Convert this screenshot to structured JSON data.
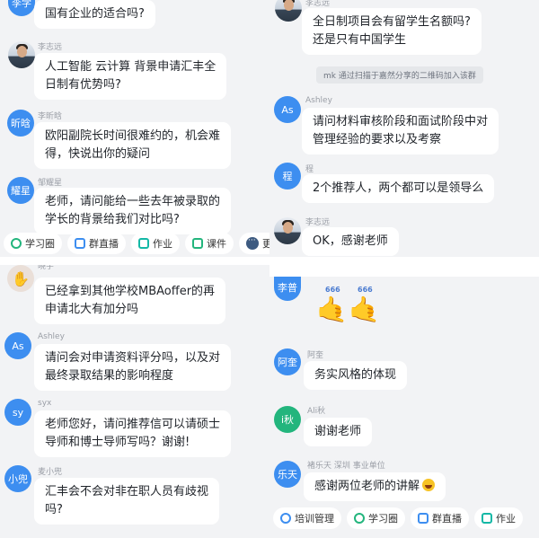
{
  "top_left": {
    "messages": [
      {
        "avatar": "李学",
        "sender": "",
        "text": "国有企业的适合吗?"
      },
      {
        "avatar": "",
        "sender": "李志远",
        "text": "人工智能 云计算 背景申请汇丰全\n日制有优势吗?"
      },
      {
        "avatar": "昕晗",
        "sender": "李昕晗",
        "text": "欧阳副院长时间很难约的，机会难\n得，快说出你的疑问"
      },
      {
        "avatar": "耀星",
        "sender": "邹耀星",
        "text": "老师，请问能给一些去年被录取的\n学长的背景给我们对比吗?"
      }
    ],
    "toolbar": [
      "学习圈",
      "群直播",
      "作业",
      "课件",
      "更多"
    ]
  },
  "top_right": {
    "messages": [
      {
        "avatar": "",
        "sender": "李志远",
        "text": "全日制项目会有留学生名额吗?\n还是只有中国学生"
      },
      {
        "avatar": "As",
        "sender": "Ashley",
        "text": "请问材料审核阶段和面试阶段中对\n管理经验的要求以及考察"
      },
      {
        "avatar": "程",
        "sender": "程",
        "text": "2个推荐人，两个都可以是领导么"
      },
      {
        "avatar": "",
        "sender": "李志远",
        "text": "OK，感谢老师"
      }
    ],
    "system_message": "mk 通过扫描于嘉然分享的二维码加入该群"
  },
  "bottom_left": {
    "messages": [
      {
        "avatar": "",
        "sender": "晓宇",
        "text": "已经拿到其他学校MBAoffer的再\n申请北大有加分吗"
      },
      {
        "avatar": "As",
        "sender": "Ashley",
        "text": "请问会对申请资料评分吗，以及对\n最终录取结果的影响程度"
      },
      {
        "avatar": "sy",
        "sender": "syx",
        "text": "老师您好，请问推荐信可以请硕士\n导师和博士导师写吗？谢谢!"
      },
      {
        "avatar": "小兜",
        "sender": "麦小兜",
        "text": "汇丰会不会对非在职人员有歧视\n吗?"
      }
    ]
  },
  "bottom_right": {
    "messages": [
      {
        "avatar": "李普",
        "sender": "",
        "text": "",
        "sticker_label": "666"
      },
      {
        "avatar": "阿奎",
        "sender": "阿奎",
        "text": "务实风格的体现"
      },
      {
        "avatar": "i秋",
        "sender": "Ali秋",
        "text": "谢谢老师"
      },
      {
        "avatar": "乐天",
        "sender": "褚乐天 深圳 事业单位",
        "text": "感谢两位老师的讲解"
      }
    ],
    "toolbar": [
      "培训管理",
      "学习圈",
      "群直播",
      "作业"
    ]
  },
  "colors": {
    "avatar_blue": "#3d8ef0",
    "avatar_green": "#23b57d",
    "chat_bg": "#f2f3f5",
    "bubble": "#ffffff"
  }
}
